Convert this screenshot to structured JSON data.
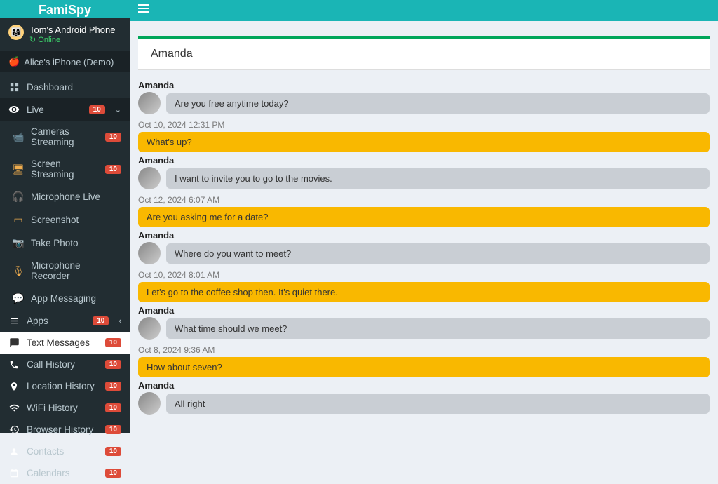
{
  "brand": "FamiSpy",
  "device": {
    "name": "Tom's Android Phone",
    "status": "Online"
  },
  "demo_device": "Alice's iPhone (Demo)",
  "nav": {
    "dashboard": "Dashboard",
    "live": {
      "label": "Live",
      "badge": "10"
    },
    "live_sub": {
      "cameras": {
        "label": "Cameras Streaming",
        "badge": "10"
      },
      "screen": {
        "label": "Screen Streaming",
        "badge": "10"
      },
      "mic_live": {
        "label": "Microphone Live"
      },
      "screenshot": {
        "label": "Screenshot"
      },
      "photo": {
        "label": "Take Photo"
      },
      "mic_rec": {
        "label": "Microphone Recorder"
      },
      "app_msg": {
        "label": "App Messaging"
      }
    },
    "apps": {
      "label": "Apps",
      "badge": "10"
    },
    "text_messages": {
      "label": "Text Messages",
      "badge": "10"
    },
    "call_history": {
      "label": "Call History",
      "badge": "10"
    },
    "location": {
      "label": "Location History",
      "badge": "10"
    },
    "wifi": {
      "label": "WiFi History",
      "badge": "10"
    },
    "browser": {
      "label": "Browser History",
      "badge": "10"
    },
    "contacts": {
      "label": "Contacts",
      "badge": "10"
    },
    "calendars": {
      "label": "Calendars",
      "badge": "10"
    }
  },
  "chat": {
    "title": "Amanda",
    "messages": [
      {
        "sender": "Amanda",
        "text": "Are you free anytime today?",
        "direction": "in"
      },
      {
        "timestamp": "Oct 10, 2024 12:31 PM"
      },
      {
        "text": "What's up?",
        "direction": "out"
      },
      {
        "sender": "Amanda",
        "text": "I want to invite you to go to the movies.",
        "direction": "in"
      },
      {
        "timestamp": "Oct 12, 2024 6:07 AM"
      },
      {
        "text": "Are you asking me for a date?",
        "direction": "out"
      },
      {
        "sender": "Amanda",
        "text": "Where do you want to meet?",
        "direction": "in"
      },
      {
        "timestamp": "Oct 10, 2024 8:01 AM"
      },
      {
        "text": "Let's go to the coffee shop then. It's quiet there.",
        "direction": "out"
      },
      {
        "sender": "Amanda",
        "text": "What time should we meet?",
        "direction": "in"
      },
      {
        "timestamp": "Oct 8, 2024 9:36 AM"
      },
      {
        "text": "How about seven?",
        "direction": "out"
      },
      {
        "sender": "Amanda",
        "text": "All right",
        "direction": "in"
      }
    ]
  }
}
